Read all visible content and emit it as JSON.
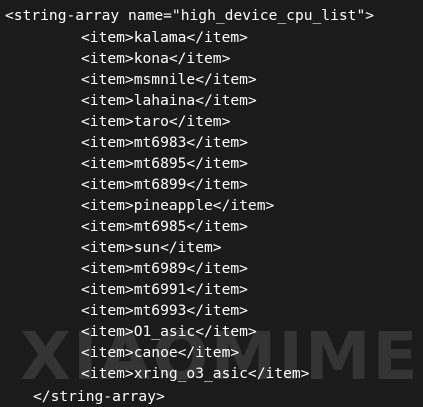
{
  "editor": {
    "open_tag": "<string-array name=\"high_device_cpu_list\">",
    "items": [
      "<item>kalama</item>",
      "<item>kona</item>",
      "<item>msmnile</item>",
      "<item>lahaina</item>",
      "<item>taro</item>",
      "<item>mt6983</item>",
      "<item>mt6895</item>",
      "<item>mt6899</item>",
      "<item>pineapple</item>",
      "<item>mt6985</item>",
      "<item>sun</item>",
      "<item>mt6989</item>",
      "<item>mt6991</item>",
      "<item>mt6993</item>",
      "<item>O1_asic</item>",
      "<item>canoe</item>",
      "<item>xring_o3_asic</item>"
    ],
    "close_tag": "</string-array>"
  },
  "watermark": {
    "text": "XIAOMIME"
  },
  "colors": {
    "background": "#1b1b1b",
    "text": "#ffffff"
  }
}
